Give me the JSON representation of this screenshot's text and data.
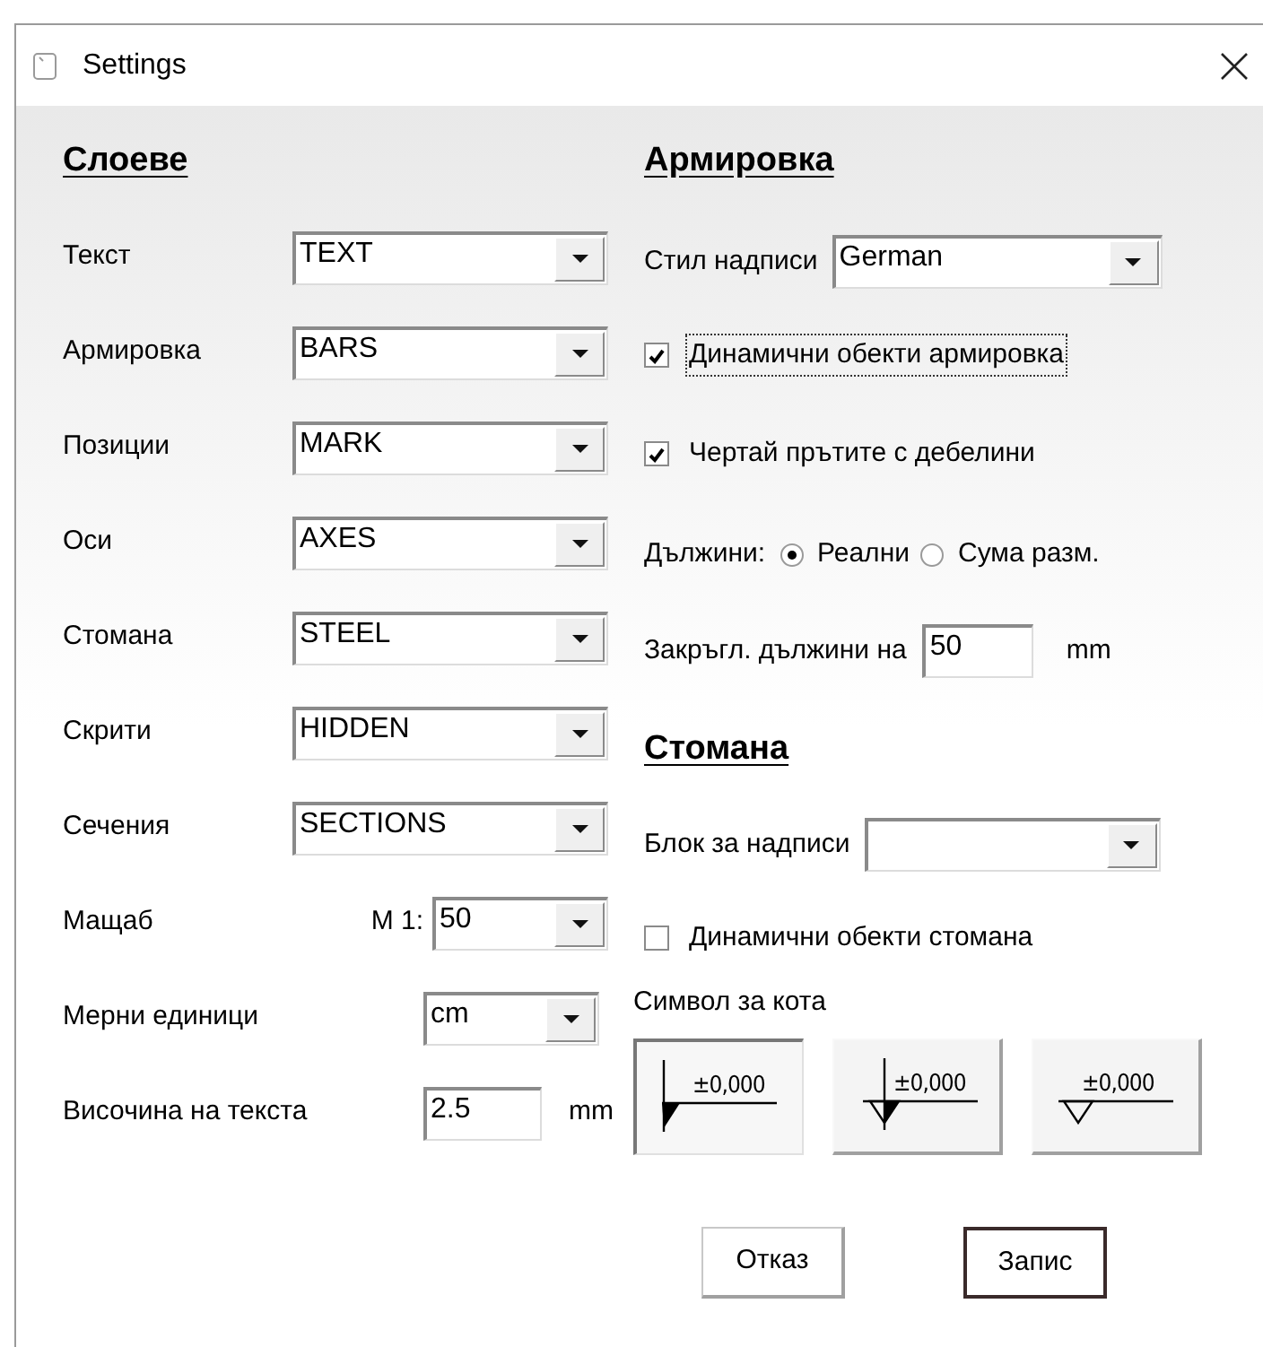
{
  "window": {
    "title": "Settings"
  },
  "layers": {
    "heading": "Слоеве",
    "rows": [
      {
        "label": "Текст",
        "value": "TEXT"
      },
      {
        "label": "Армировка",
        "value": "BARS"
      },
      {
        "label": "Позиции",
        "value": "MARK"
      },
      {
        "label": "Оси",
        "value": "AXES"
      },
      {
        "label": "Стомана",
        "value": "STEEL"
      },
      {
        "label": "Скрити",
        "value": "HIDDEN"
      },
      {
        "label": "Сечения",
        "value": "SECTIONS"
      },
      {
        "label": "Мащаб",
        "prefix": "M 1:",
        "value": "50"
      },
      {
        "label": "Мерни единици",
        "value": "cm"
      }
    ],
    "text_height": {
      "label": "Височина на текста",
      "value": "2.5",
      "unit": "mm"
    }
  },
  "reinforcement": {
    "heading": "Армировка",
    "label_style": {
      "label": "Стил надписи",
      "value": "German"
    },
    "checkboxes": [
      {
        "label": "Динамични обекти армировка",
        "checked": true,
        "focused": true
      },
      {
        "label": "Чертай прътите с дебелини",
        "checked": true,
        "focused": false
      }
    ],
    "lengths": {
      "label": "Дължини:",
      "options": [
        {
          "label": "Реални",
          "selected": true
        },
        {
          "label": "Сума разм.",
          "selected": false
        }
      ]
    },
    "rounding": {
      "label": "Закръгл. дължини на",
      "value": "50",
      "unit": "mm"
    }
  },
  "steel": {
    "heading": "Стомана",
    "label_block": {
      "label": "Блок за надписи"
    },
    "checkbox": {
      "label": "Динамични обекти стомана",
      "checked": false
    },
    "level_symbol": {
      "label": "Символ за кота",
      "options": [
        {
          "kind": "filled",
          "text": "±0,000",
          "selected": true
        },
        {
          "kind": "half",
          "text": "±0,000",
          "selected": false
        },
        {
          "kind": "open",
          "text": "±0,000",
          "selected": false
        }
      ]
    }
  },
  "buttons": [
    {
      "label": "Отказ",
      "default": false
    },
    {
      "label": "Запис",
      "default": true
    }
  ]
}
